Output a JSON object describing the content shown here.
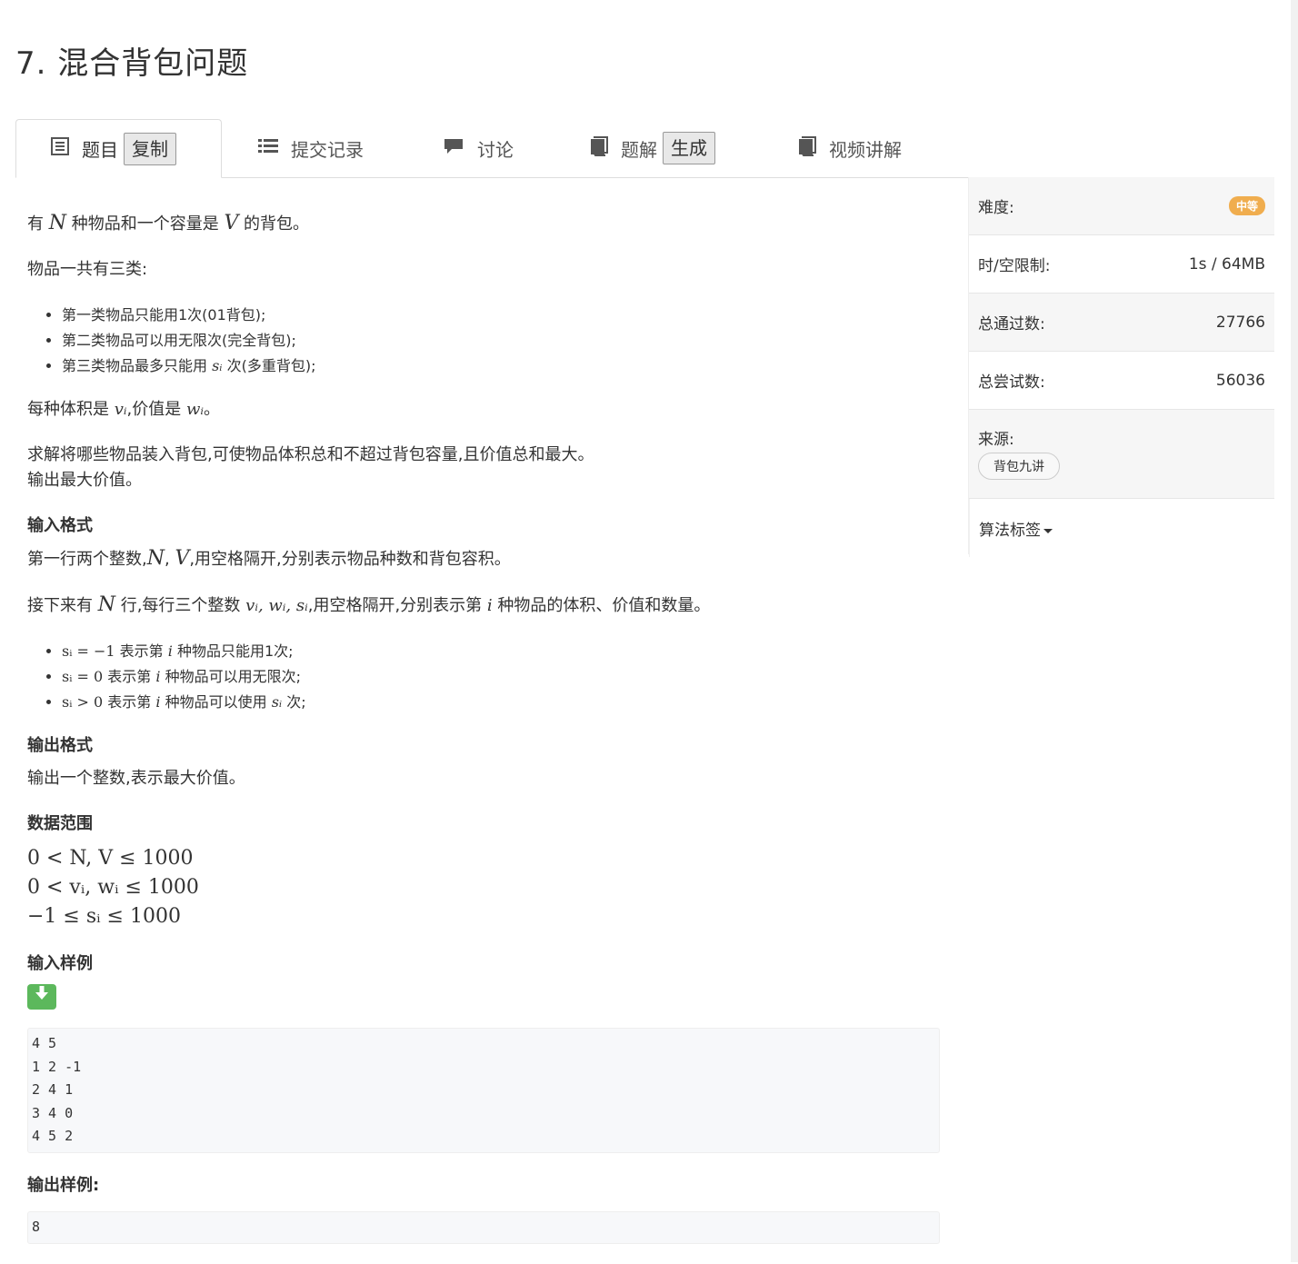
{
  "problem": {
    "title": "7. 混合背包问题"
  },
  "tabs": {
    "problem": "题目",
    "copy": "复制",
    "submissions": "提交记录",
    "discussion": "讨论",
    "solutions": "题解",
    "generate": "生成",
    "video": "视频讲解"
  },
  "sidebar": {
    "difficulty_label": "难度:",
    "difficulty_value": "中等",
    "difficulty_color": "#f0ad4e",
    "limit_label": "时/空限制:",
    "limit_value": "1s / 64MB",
    "accepted_label": "总通过数:",
    "accepted_value": "27766",
    "attempts_label": "总尝试数:",
    "attempts_value": "56036",
    "source_label": "来源:",
    "source_tag": "背包九讲",
    "algo_label": "算法标签"
  },
  "desc": {
    "p1_a": "有 ",
    "p1_N": "N",
    "p1_b": " 种物品和一个容量是 ",
    "p1_V": "V",
    "p1_c": " 的背包。",
    "p2": "物品一共有三类:",
    "li1": "第一类物品只能用1次(01背包);",
    "li2": "第二类物品可以用无限次(完全背包);",
    "li3_a": "第三类物品最多只能用 ",
    "li3_s": "sᵢ",
    "li3_b": " 次(多重背包);",
    "p3_a": "每种体积是 ",
    "p3_v": "vᵢ",
    "p3_b": ",价值是 ",
    "p3_w": "wᵢ",
    "p3_c": "。",
    "p4_1": "求解将哪些物品装入背包,可使物品体积总和不超过背包容量,且价值总和最大。",
    "p4_2": "输出最大价值。"
  },
  "input_format": {
    "heading": "输入格式",
    "p1_a": "第一行两个整数,",
    "p1_N": "N",
    "p1_b": ", ",
    "p1_V": "V",
    "p1_c": ",用空格隔开,分别表示物品种数和背包容积。",
    "p2_a": "接下来有 ",
    "p2_N": "N",
    "p2_b": " 行,每行三个整数 ",
    "p2_vars": "vᵢ, wᵢ, sᵢ",
    "p2_c": ",用空格隔开,分别表示第 ",
    "p2_i": "i",
    "p2_d": " 种物品的体积、价值和数量。",
    "li1_m": "sᵢ = −1",
    "li1_a": " 表示第 ",
    "li1_i": "i",
    "li1_b": " 种物品只能用1次;",
    "li2_m": "sᵢ = 0",
    "li2_a": " 表示第 ",
    "li2_i": "i",
    "li2_b": " 种物品可以用无限次;",
    "li3_m": "sᵢ > 0",
    "li3_a": " 表示第 ",
    "li3_i": "i",
    "li3_b": " 种物品可以使用 ",
    "li3_s": "sᵢ",
    "li3_c": " 次;"
  },
  "output_format": {
    "heading": "输出格式",
    "text": "输出一个整数,表示最大价值。"
  },
  "data_range": {
    "heading": "数据范围",
    "line1": "0 < N, V ≤ 1000",
    "line2": "0 < vᵢ, wᵢ ≤ 1000",
    "line3": "−1 ≤ sᵢ ≤ 1000"
  },
  "sample_input": {
    "heading": "输入样例",
    "text": "4 5\n1 2 -1\n2 4 1\n3 4 0\n4 5 2"
  },
  "sample_output": {
    "heading": "输出样例:",
    "text": "8"
  }
}
